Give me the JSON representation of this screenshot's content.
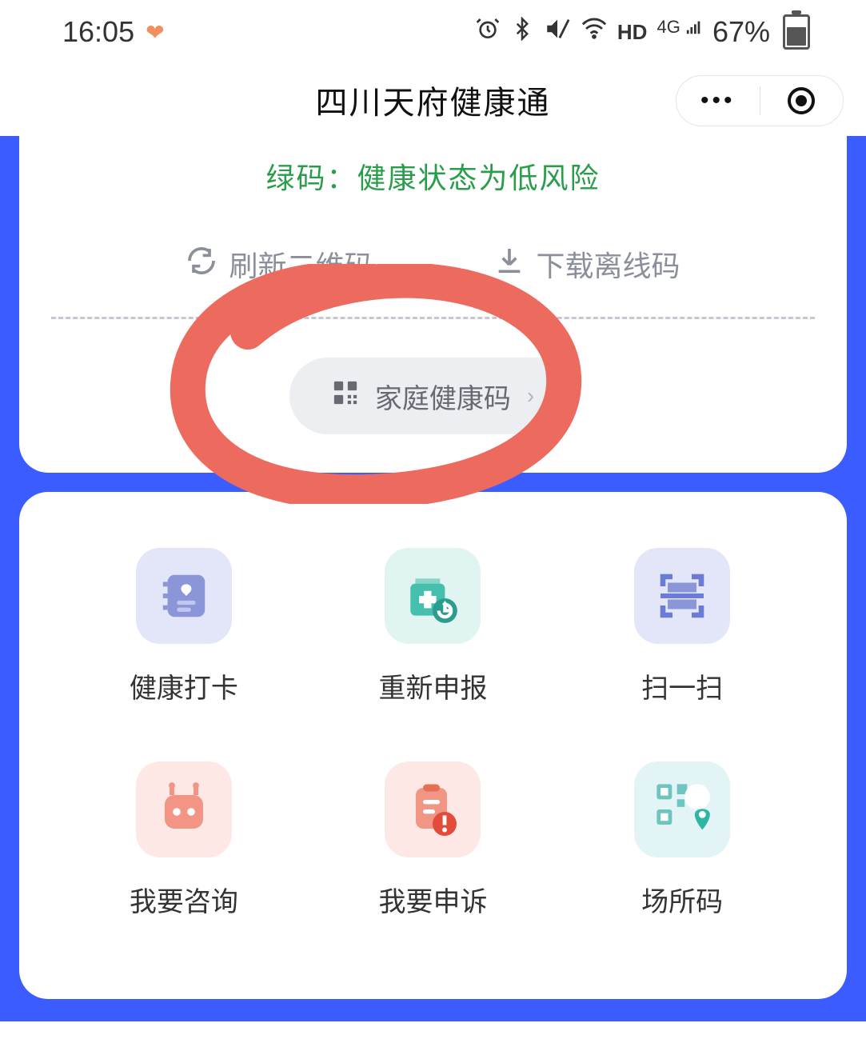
{
  "status_bar": {
    "time": "16:05",
    "battery_text": "67%",
    "hd_label": "HD",
    "net_label": "4G"
  },
  "nav": {
    "title": "四川天府健康通"
  },
  "health_status": {
    "text": "绿码：健康状态为低风险"
  },
  "actions": {
    "refresh_label": "刷新二维码",
    "download_label": "下载离线码"
  },
  "family_code": {
    "label": "家庭健康码"
  },
  "grid": {
    "items": [
      {
        "label": "健康打卡"
      },
      {
        "label": "重新申报"
      },
      {
        "label": "扫一扫"
      },
      {
        "label": "我要咨询"
      },
      {
        "label": "我要申诉"
      },
      {
        "label": "场所码"
      }
    ]
  }
}
